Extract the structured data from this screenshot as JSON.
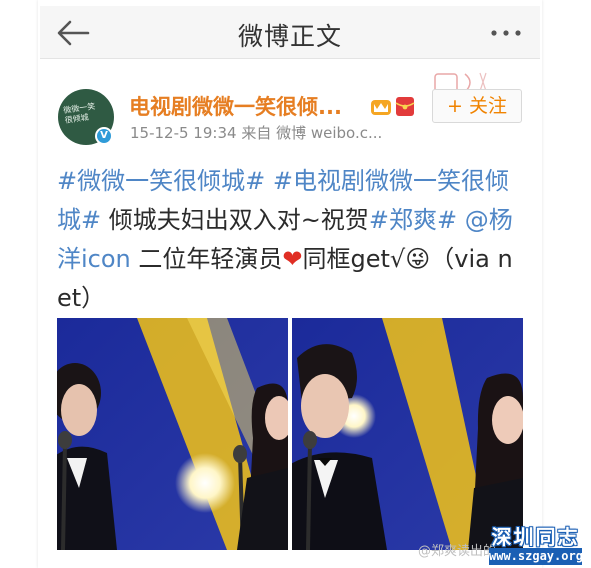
{
  "nav": {
    "title": "微博正文"
  },
  "author": {
    "name": "电视剧微微一笑很倾...",
    "avatar_text_line1": "微微一笑",
    "avatar_text_line2": "很倾城",
    "verified_mark": "V",
    "timestamp": "15-12-5 19:34",
    "source": "来自 微博 weibo.c...",
    "follow_label": "+ 关注"
  },
  "post": {
    "topic1": "#微微一笑很倾城#",
    "topic2": "#电视剧微微一笑很倾城#",
    "text1": " 倾城夫妇出双入对~祝贺",
    "topic3": "#郑爽#",
    "mention": " @杨洋icon",
    "text2": " 二位年轻演员",
    "heart": "❤",
    "text3": "同框get√",
    "face": "😜",
    "text4": "（via net）"
  },
  "watermarks": {
    "weibo_handle": "@郑爽读出的",
    "site_name": "深圳同志",
    "site_url": "www.szgay.org"
  },
  "colors": {
    "link": "#4f86c6",
    "author_name": "#e67e22",
    "follow": "#f08300",
    "stage_blue": "#1e2a8e"
  },
  "icons": {
    "back": "arrow-left-icon",
    "more": "more-dots-icon",
    "verified": "verified-badge-icon",
    "member": "crown-icon",
    "red_packet": "red-packet-icon"
  }
}
